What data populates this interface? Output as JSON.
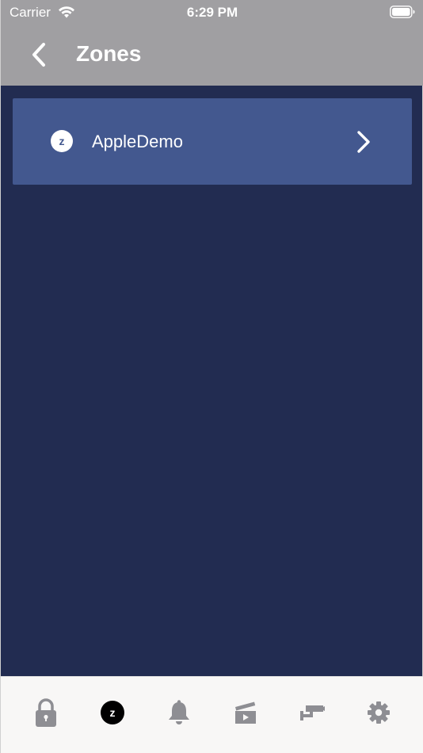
{
  "status_bar": {
    "carrier": "Carrier",
    "time": "6:29 PM",
    "wifi_icon": "wifi-icon",
    "battery_icon": "battery-icon"
  },
  "nav": {
    "back_icon": "chevron-left-icon",
    "title": "Zones"
  },
  "zones": [
    {
      "badge": "z",
      "name": "AppleDemo",
      "chevron_icon": "chevron-right-icon"
    }
  ],
  "tab_bar": {
    "tabs": [
      {
        "icon": "lock-icon",
        "selected": false
      },
      {
        "icon": "zones-icon",
        "badge": "z",
        "selected": true
      },
      {
        "icon": "bell-icon",
        "selected": false
      },
      {
        "icon": "clapperboard-icon",
        "selected": false
      },
      {
        "icon": "security-camera-icon",
        "selected": false
      },
      {
        "icon": "gear-icon",
        "selected": false
      }
    ]
  },
  "colors": {
    "header": "#a09fa2",
    "background": "#222c51",
    "zone_row": "#43588f",
    "tab_bar": "#f8f7f6",
    "tab_icon": "#8e8e93",
    "tab_selected": "#000000"
  }
}
